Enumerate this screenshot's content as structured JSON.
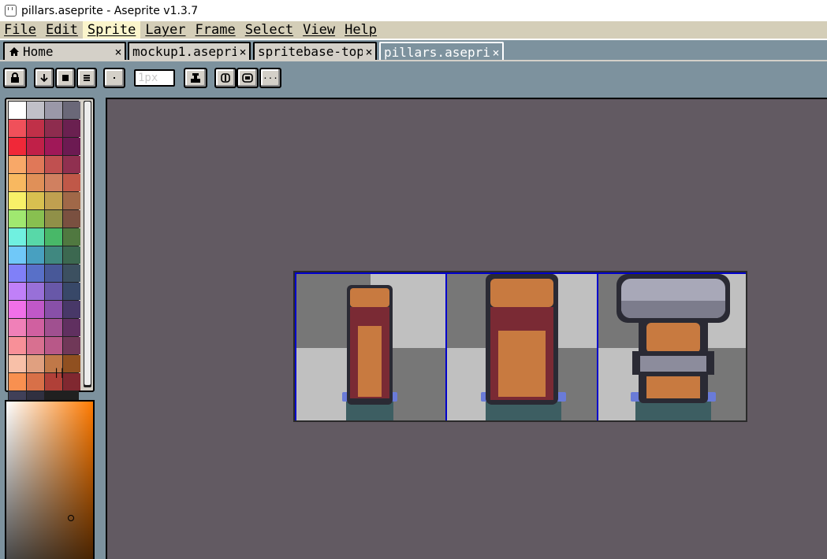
{
  "window": {
    "title": "pillars.aseprite - Aseprite v1.3.7"
  },
  "menu": [
    "File",
    "Edit",
    "Sprite",
    "Layer",
    "Frame",
    "Select",
    "View",
    "Help"
  ],
  "active_menu": "Sprite",
  "tabs": [
    {
      "label": "Home",
      "close": "×",
      "icon": "home-icon"
    },
    {
      "label": "mockup1.asepri",
      "close": "×"
    },
    {
      "label": "spritebase-top\\",
      "close": "×"
    },
    {
      "label": "pillars.aseprite",
      "close": "×",
      "active": true
    }
  ],
  "toolbar": {
    "brush_size": "1px",
    "icons": [
      "lock-icon",
      "arrow-down-icon",
      "square-icon",
      "menu-icon",
      "dot-icon",
      "ink-icon",
      "symmetry-icon",
      "tiles-icon",
      "more-icon"
    ],
    "more_label": "···"
  },
  "palette": {
    "colors": [
      "#ffffff",
      "#c0c0c8",
      "#9a98a8",
      "#6a6878",
      "#f0505a",
      "#c03048",
      "#8e2c4e",
      "#6a2050",
      "#f02838",
      "#c02048",
      "#a01858",
      "#6c1a52",
      "#f8a868",
      "#e07858",
      "#c05050",
      "#903050",
      "#f8b860",
      "#e09058",
      "#d08060",
      "#c05848",
      "#f8f068",
      "#d8c050",
      "#c0a050",
      "#a06848",
      "#a0e870",
      "#88c050",
      "#909048",
      "#7a5040",
      "#70f0e0",
      "#58d8a8",
      "#48b868",
      "#507840",
      "#70c8f8",
      "#48a0c0",
      "#408880",
      "#3c6850",
      "#8080f8",
      "#5870c8",
      "#485898",
      "#3c5060",
      "#c080f8",
      "#9870d8",
      "#6858a8",
      "#384868",
      "#f070e8",
      "#c058c8",
      "#8850a8",
      "#483868",
      "#f080b8",
      "#d060a0",
      "#a05090",
      "#603060",
      "#f89098",
      "#d87090",
      "#b85888",
      "#703858",
      "#f8c0a8",
      "#e0a080",
      "#c07848",
      "#905020",
      "#f89050",
      "#d87048",
      "#b04038",
      "#802830",
      "#404058",
      "#303040"
    ],
    "separator_glyph": "||"
  },
  "colors": {
    "menubar_bg": "#d4ceb8",
    "menu_active_bg": "#fbf5cc",
    "ui_slate": "#7d929e",
    "editor_bg": "#625a62",
    "frame_line": "#0000cc"
  }
}
